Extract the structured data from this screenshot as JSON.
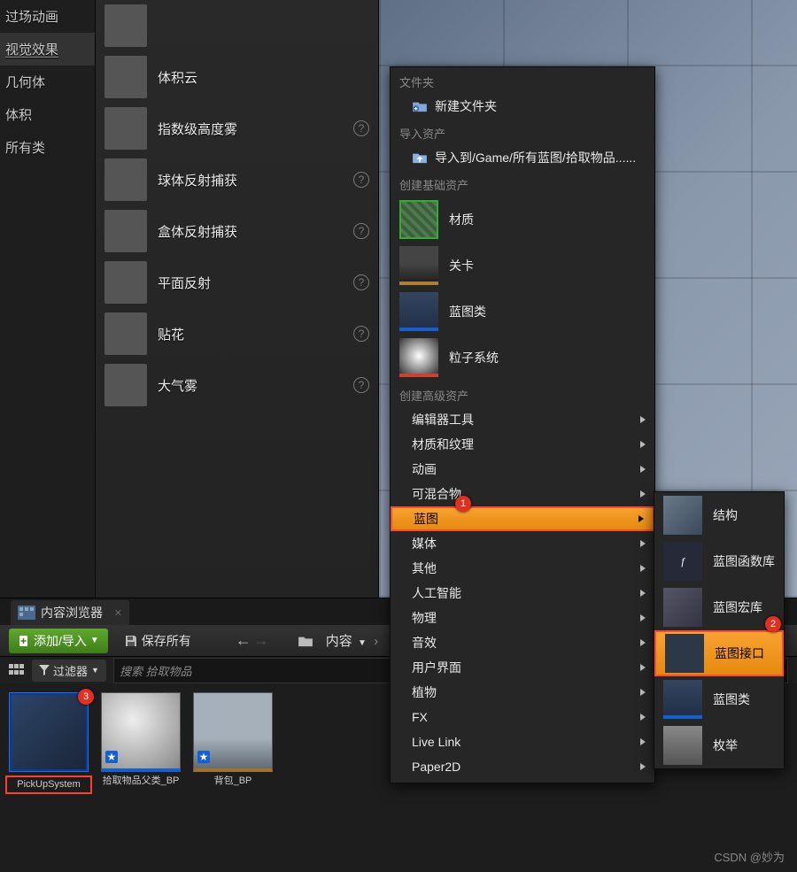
{
  "sidebar": {
    "categories": [
      {
        "label": "过场动画"
      },
      {
        "label": "视觉效果"
      },
      {
        "label": "几何体"
      },
      {
        "label": "体积"
      },
      {
        "label": "所有类"
      }
    ],
    "selected_index": 1
  },
  "asset_list": [
    {
      "label": "",
      "has_help": false
    },
    {
      "label": "体积云",
      "has_help": false
    },
    {
      "label": "指数级高度雾",
      "has_help": true
    },
    {
      "label": "球体反射捕获",
      "has_help": true
    },
    {
      "label": "盒体反射捕获",
      "has_help": true
    },
    {
      "label": "平面反射",
      "has_help": true
    },
    {
      "label": "贴花",
      "has_help": true
    },
    {
      "label": "大气雾",
      "has_help": true
    }
  ],
  "context_menu": {
    "folder_section": "文件夹",
    "new_folder": "新建文件夹",
    "import_section": "导入资产",
    "import_to": "导入到/Game/所有蓝图/拾取物品......",
    "basic_section": "创建基础资产",
    "basic_items": [
      {
        "label": "材质",
        "tile": "tile-material"
      },
      {
        "label": "关卡",
        "tile": "tile-level"
      },
      {
        "label": "蓝图类",
        "tile": "tile-bp"
      },
      {
        "label": "粒子系统",
        "tile": "tile-particle"
      }
    ],
    "advanced_section": "创建高级资产",
    "advanced_items": [
      "编辑器工具",
      "材质和纹理",
      "动画",
      "可混合物",
      "蓝图",
      "媒体",
      "其他",
      "人工智能",
      "物理",
      "音效",
      "用户界面",
      "植物",
      "FX",
      "Live Link",
      "Paper2D"
    ],
    "highlighted_index": 4
  },
  "submenu": {
    "items": [
      {
        "label": "结构",
        "tile": "tile-struct"
      },
      {
        "label": "蓝图函数库",
        "tile": "tile-func"
      },
      {
        "label": "蓝图宏库",
        "tile": "tile-macro"
      },
      {
        "label": "蓝图接口",
        "tile": "tile-gear"
      },
      {
        "label": "蓝图类",
        "tile": "tile-bp"
      },
      {
        "label": "枚举",
        "tile": "tile-enum"
      }
    ],
    "highlighted_index": 3
  },
  "callouts": {
    "c1": "1",
    "c2": "2",
    "c3": "3"
  },
  "content_browser": {
    "tab": "内容浏览器",
    "add_button": "添加/导入",
    "save_all": "保存所有",
    "breadcrumb": "内容",
    "filter_label": "过滤器",
    "search_placeholder": "搜索 拾取物品",
    "assets": [
      {
        "name": "PickUpSystem",
        "thumb_class": "bp-int",
        "selected": true,
        "redbox": true
      },
      {
        "name": "拾取物品父类_BP",
        "thumb_class": "bp-class",
        "star": true
      },
      {
        "name": "背包_BP",
        "thumb_class": "level",
        "star": true
      }
    ]
  },
  "watermark": "CSDN @妙为"
}
